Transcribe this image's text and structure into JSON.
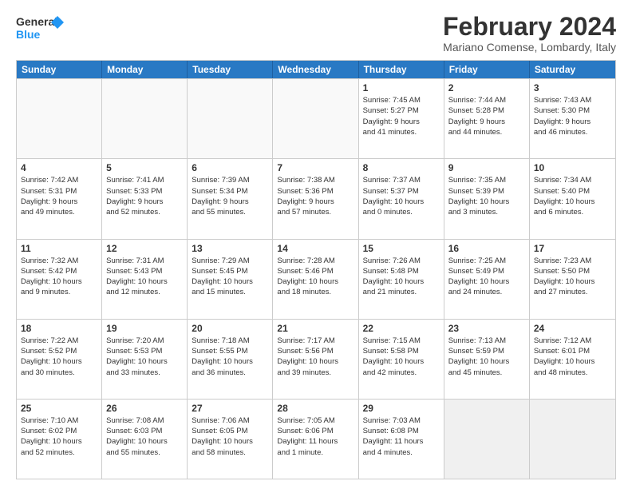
{
  "logo": {
    "line1": "General",
    "line2": "Blue"
  },
  "title": "February 2024",
  "subtitle": "Mariano Comense, Lombardy, Italy",
  "days_of_week": [
    "Sunday",
    "Monday",
    "Tuesday",
    "Wednesday",
    "Thursday",
    "Friday",
    "Saturday"
  ],
  "weeks": [
    [
      {
        "day": "",
        "info": ""
      },
      {
        "day": "",
        "info": ""
      },
      {
        "day": "",
        "info": ""
      },
      {
        "day": "",
        "info": ""
      },
      {
        "day": "1",
        "info": "Sunrise: 7:45 AM\nSunset: 5:27 PM\nDaylight: 9 hours\nand 41 minutes."
      },
      {
        "day": "2",
        "info": "Sunrise: 7:44 AM\nSunset: 5:28 PM\nDaylight: 9 hours\nand 44 minutes."
      },
      {
        "day": "3",
        "info": "Sunrise: 7:43 AM\nSunset: 5:30 PM\nDaylight: 9 hours\nand 46 minutes."
      }
    ],
    [
      {
        "day": "4",
        "info": "Sunrise: 7:42 AM\nSunset: 5:31 PM\nDaylight: 9 hours\nand 49 minutes."
      },
      {
        "day": "5",
        "info": "Sunrise: 7:41 AM\nSunset: 5:33 PM\nDaylight: 9 hours\nand 52 minutes."
      },
      {
        "day": "6",
        "info": "Sunrise: 7:39 AM\nSunset: 5:34 PM\nDaylight: 9 hours\nand 55 minutes."
      },
      {
        "day": "7",
        "info": "Sunrise: 7:38 AM\nSunset: 5:36 PM\nDaylight: 9 hours\nand 57 minutes."
      },
      {
        "day": "8",
        "info": "Sunrise: 7:37 AM\nSunset: 5:37 PM\nDaylight: 10 hours\nand 0 minutes."
      },
      {
        "day": "9",
        "info": "Sunrise: 7:35 AM\nSunset: 5:39 PM\nDaylight: 10 hours\nand 3 minutes."
      },
      {
        "day": "10",
        "info": "Sunrise: 7:34 AM\nSunset: 5:40 PM\nDaylight: 10 hours\nand 6 minutes."
      }
    ],
    [
      {
        "day": "11",
        "info": "Sunrise: 7:32 AM\nSunset: 5:42 PM\nDaylight: 10 hours\nand 9 minutes."
      },
      {
        "day": "12",
        "info": "Sunrise: 7:31 AM\nSunset: 5:43 PM\nDaylight: 10 hours\nand 12 minutes."
      },
      {
        "day": "13",
        "info": "Sunrise: 7:29 AM\nSunset: 5:45 PM\nDaylight: 10 hours\nand 15 minutes."
      },
      {
        "day": "14",
        "info": "Sunrise: 7:28 AM\nSunset: 5:46 PM\nDaylight: 10 hours\nand 18 minutes."
      },
      {
        "day": "15",
        "info": "Sunrise: 7:26 AM\nSunset: 5:48 PM\nDaylight: 10 hours\nand 21 minutes."
      },
      {
        "day": "16",
        "info": "Sunrise: 7:25 AM\nSunset: 5:49 PM\nDaylight: 10 hours\nand 24 minutes."
      },
      {
        "day": "17",
        "info": "Sunrise: 7:23 AM\nSunset: 5:50 PM\nDaylight: 10 hours\nand 27 minutes."
      }
    ],
    [
      {
        "day": "18",
        "info": "Sunrise: 7:22 AM\nSunset: 5:52 PM\nDaylight: 10 hours\nand 30 minutes."
      },
      {
        "day": "19",
        "info": "Sunrise: 7:20 AM\nSunset: 5:53 PM\nDaylight: 10 hours\nand 33 minutes."
      },
      {
        "day": "20",
        "info": "Sunrise: 7:18 AM\nSunset: 5:55 PM\nDaylight: 10 hours\nand 36 minutes."
      },
      {
        "day": "21",
        "info": "Sunrise: 7:17 AM\nSunset: 5:56 PM\nDaylight: 10 hours\nand 39 minutes."
      },
      {
        "day": "22",
        "info": "Sunrise: 7:15 AM\nSunset: 5:58 PM\nDaylight: 10 hours\nand 42 minutes."
      },
      {
        "day": "23",
        "info": "Sunrise: 7:13 AM\nSunset: 5:59 PM\nDaylight: 10 hours\nand 45 minutes."
      },
      {
        "day": "24",
        "info": "Sunrise: 7:12 AM\nSunset: 6:01 PM\nDaylight: 10 hours\nand 48 minutes."
      }
    ],
    [
      {
        "day": "25",
        "info": "Sunrise: 7:10 AM\nSunset: 6:02 PM\nDaylight: 10 hours\nand 52 minutes."
      },
      {
        "day": "26",
        "info": "Sunrise: 7:08 AM\nSunset: 6:03 PM\nDaylight: 10 hours\nand 55 minutes."
      },
      {
        "day": "27",
        "info": "Sunrise: 7:06 AM\nSunset: 6:05 PM\nDaylight: 10 hours\nand 58 minutes."
      },
      {
        "day": "28",
        "info": "Sunrise: 7:05 AM\nSunset: 6:06 PM\nDaylight: 11 hours\nand 1 minute."
      },
      {
        "day": "29",
        "info": "Sunrise: 7:03 AM\nSunset: 6:08 PM\nDaylight: 11 hours\nand 4 minutes."
      },
      {
        "day": "",
        "info": ""
      },
      {
        "day": "",
        "info": ""
      }
    ]
  ]
}
